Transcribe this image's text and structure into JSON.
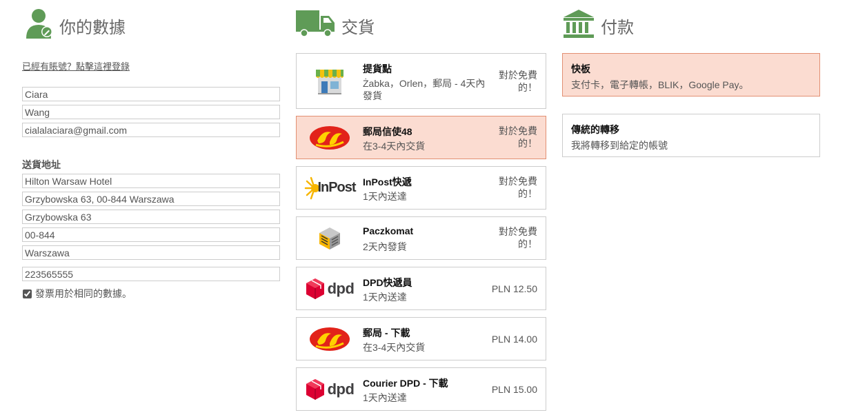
{
  "sections": {
    "data_title": "你的數據",
    "delivery_title": "交貨",
    "payment_title": "付款"
  },
  "account": {
    "login_link": "已經有賬號？點擊這裡登錄"
  },
  "form": {
    "first_name": "Ciara",
    "last_name": "Wang",
    "email": "cialalaciara@gmail.com",
    "address_label": "送貨地址",
    "company": "Hilton Warsaw Hotel",
    "address_line": "Grzybowska 63, 00-844 Warszawa",
    "street": "Grzybowska 63",
    "postcode": "00-844",
    "city": "Warszawa",
    "phone": "223565555",
    "invoice_same_checked": true,
    "invoice_same_label": "發票用於相同的數據。"
  },
  "delivery_options": [
    {
      "name": "提貨點",
      "desc": "Żabka，Orlen，郵局 - 4天內發貨",
      "price": "對於免費的！",
      "logo": "shop-icon",
      "selected": false
    },
    {
      "name": "郵局信使48",
      "desc": "在3-4天內交貨",
      "price": "對於免費的！",
      "logo": "poczta-logo",
      "selected": true
    },
    {
      "name": "InPost快遞",
      "desc": "1天內送達",
      "price": "對於免費的！",
      "logo": "inpost-logo",
      "logo_text": "InPost",
      "selected": false
    },
    {
      "name": "Paczkomat",
      "desc": "2天內發貨",
      "price": "對於免費的！",
      "logo": "paczkomat-logo",
      "selected": false
    },
    {
      "name": "DPD快遞員",
      "desc": "1天內送達",
      "price": "PLN 12.50",
      "logo": "dpd-logo",
      "logo_text": "dpd",
      "selected": false
    },
    {
      "name": "郵局 - 下載",
      "desc": "在3-4天內交貨",
      "price": "PLN 14.00",
      "logo": "poczta-logo",
      "selected": false
    },
    {
      "name": "Courier DPD - 下載",
      "desc": "1天內送達",
      "price": "PLN 15.00",
      "logo": "dpd-logo",
      "logo_text": "dpd",
      "selected": false
    }
  ],
  "payment_options": [
    {
      "name": "快板",
      "desc": "支付卡，電子轉帳，BLIK，Google Pay。",
      "selected": true
    },
    {
      "name": "傳統的轉移",
      "desc": "我將轉移到給定的帳號",
      "selected": false
    }
  ],
  "colors": {
    "icon_green": "#5f9b57",
    "selected_bg": "#fbdcd1",
    "selected_border": "#e28f72",
    "poczta_red": "#e2231a",
    "poczta_yellow": "#ffd200",
    "dpd_red": "#dc0032"
  }
}
